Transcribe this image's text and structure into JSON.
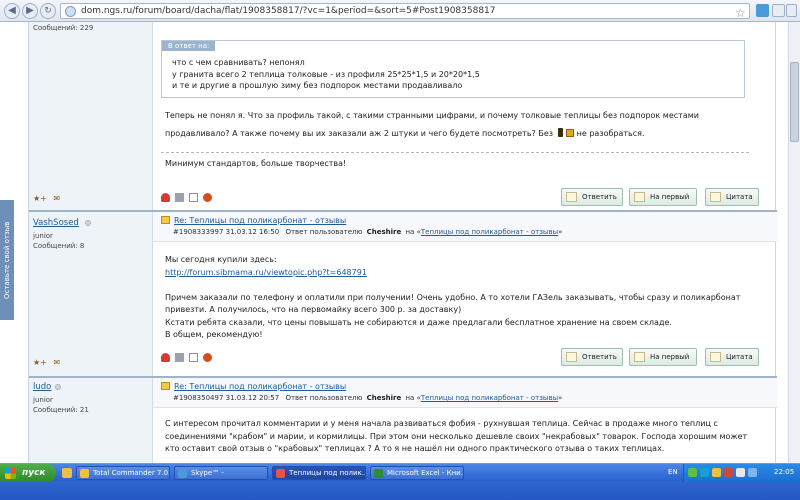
{
  "browser": {
    "url": "dom.ngs.ru/forum/board/dacha/flat/1908358817/?vc=1&period=&sort=5#Post1908358817",
    "back_icon": "back-arrow-icon",
    "forward_icon": "forward-arrow-icon"
  },
  "side_tab": {
    "label": "Оставьте свой отзыв"
  },
  "post1": {
    "msgcount": "Сообщений: 229",
    "quote_label": "В ответ на:",
    "quote_lines": [
      "что с чем сравнивать? непонял",
      "у гранита всего 2 теплица толковые - из профиля 25*25*1,5 и 20*20*1,5",
      "и те и другие в прошлую зиму без подпорок местами продавливало"
    ],
    "text_lines": [
      "Теперь не понял я. Что за профиль такой, с такими странными цифрами, и почему толковые теплицы без подпорок местами",
      "продавливало? А также почему вы их заказали аж 2 штуки и чего будете посмотреть? Без",
      "не разобраться."
    ],
    "signature": "Минимум стандартов, больше творчества!"
  },
  "buttons": {
    "reply": "Ответить",
    "to_first": "На первый",
    "quote": "Цитата"
  },
  "post2": {
    "username": "VashSosed",
    "rank": "junior",
    "msgcount": "Сообщений: 8",
    "title": "Re: Теплицы под поликарбонат - отзывы",
    "meta_id": "#1908333997 31.03.12 16:50",
    "meta_reply": "Ответ пользователю",
    "meta_user": "Cheshire",
    "meta_on": "на «",
    "meta_link": "Теплицы под поликарбонат - отзывы",
    "meta_end": "»",
    "lines": [
      "Мы сегодня купили здесь:",
      "http://forum.sibmama.ru/viewtopic.php?t=648791",
      "",
      "Причем заказали по телефону и оплатили при получении! Очень удобно. А то хотели ГАЗель заказывать, чтобы сразу и поликарбонат",
      "привезти. А получилось, что на первомайку всего 300 р. за доставку)",
      "Кстати ребята сказали, что цены повышать не собираются и даже предлагали бесплатное хранение на своем складе.",
      "В общем, рекомендую!"
    ]
  },
  "post3": {
    "username": "ludo",
    "rank": "junior",
    "msgcount": "Сообщений: 21",
    "title": "Re: Теплицы под поликарбонат - отзывы",
    "meta_id": "#1908350497 31.03.12 20:57",
    "meta_reply": "Ответ пользователю",
    "meta_user": "Cheshire",
    "meta_on": "на «",
    "meta_link": "Теплицы под поликарбонат - отзывы",
    "meta_end": "»",
    "lines": [
      "С интересом прочитал комментарии и у меня начала развиваться фобия - рухнувшая теплица. Сейчас в продаже много теплиц с",
      "соединениями \"крабом\" и марии, и кормилицы. При этом они несколько дешевле своих \"некрабовых\" товарок. Господа хорошим может",
      "кто оставит свой отзыв о \"крабовых\" теплицах ? А то я не нашёл ни одного практического отзыва о таких теплицах."
    ]
  },
  "taskbar": {
    "start": "пуск",
    "tasks": [
      "Total Commander 7.0...",
      "Skype™ -",
      "Теплицы под полик...",
      "Microsoft Excel - Кни..."
    ],
    "lang": "EN",
    "clock": "22:05"
  },
  "colors": {
    "link": "#1f5a99",
    "taskbar": "#2458c4",
    "start": "#3b9a37"
  }
}
